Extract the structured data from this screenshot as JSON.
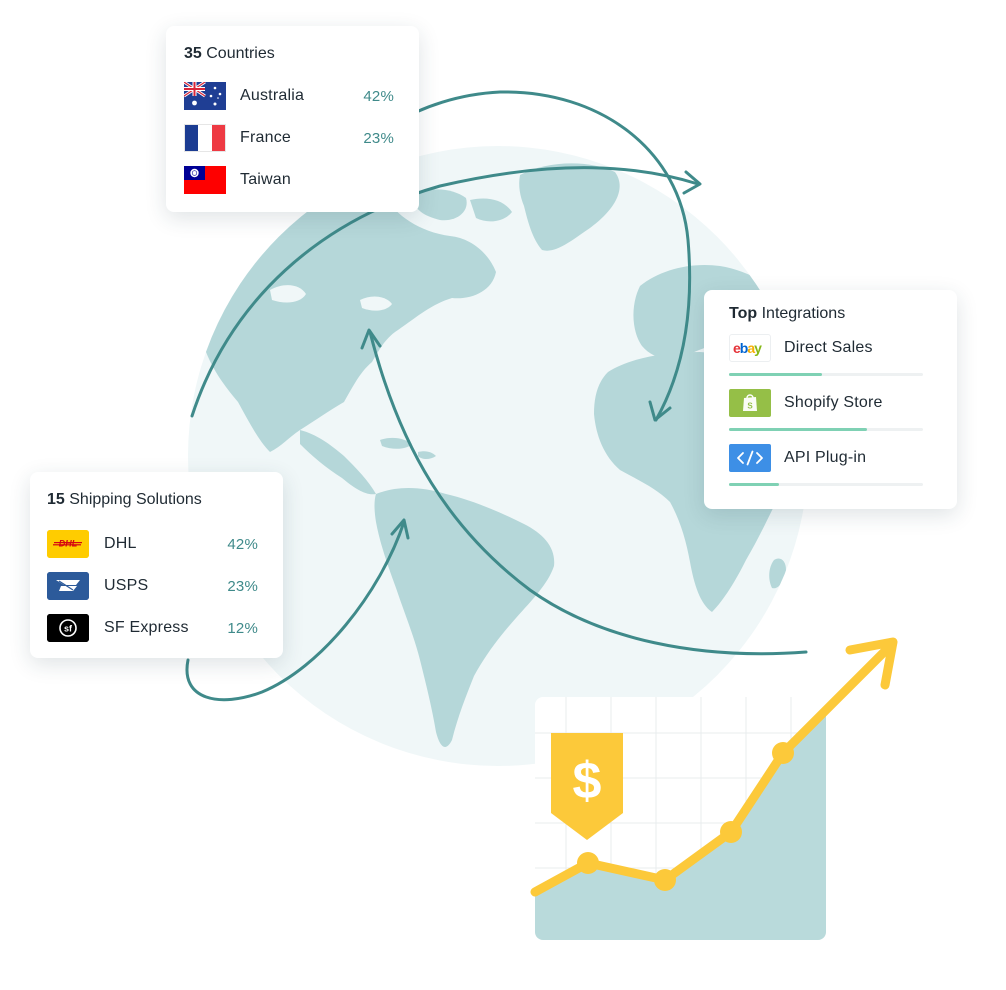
{
  "countries": {
    "count": "35",
    "title_rest": "Countries",
    "items": [
      {
        "name": "Australia",
        "pct": "42%",
        "flag": "australia-flag"
      },
      {
        "name": "France",
        "pct": "23%",
        "flag": "france-flag"
      },
      {
        "name": "Taiwan",
        "pct": "",
        "flag": "taiwan-flag"
      }
    ]
  },
  "shipping": {
    "count": "15",
    "title_rest": "Shipping Solutions",
    "items": [
      {
        "name": "DHL",
        "pct": "42%",
        "logo": "dhl-logo"
      },
      {
        "name": "USPS",
        "pct": "23%",
        "logo": "usps-logo"
      },
      {
        "name": "SF Express",
        "pct": "12%",
        "logo": "sf-express-logo"
      }
    ]
  },
  "integrations": {
    "bold": "Top",
    "title_rest": "Integrations",
    "items": [
      {
        "name": "Direct Sales",
        "logo": "ebay-logo",
        "level": 0.48
      },
      {
        "name": "Shopify Store",
        "logo": "shopify-logo",
        "level": 0.71
      },
      {
        "name": "API Plug-in",
        "logo": "code-icon",
        "level": 0.26
      }
    ]
  },
  "growth": {
    "symbol": "$",
    "icon": "dollar-tag-icon",
    "trend_icon": "arrow-up-right-icon"
  },
  "colors": {
    "accent_teal": "#3f8a8a",
    "globe_ocean": "#f0f7f8",
    "globe_land": "#b5d7d9",
    "progress": "#7fd1b4",
    "growth_line": "#fcc93a",
    "growth_fill": "#b9dadb"
  }
}
